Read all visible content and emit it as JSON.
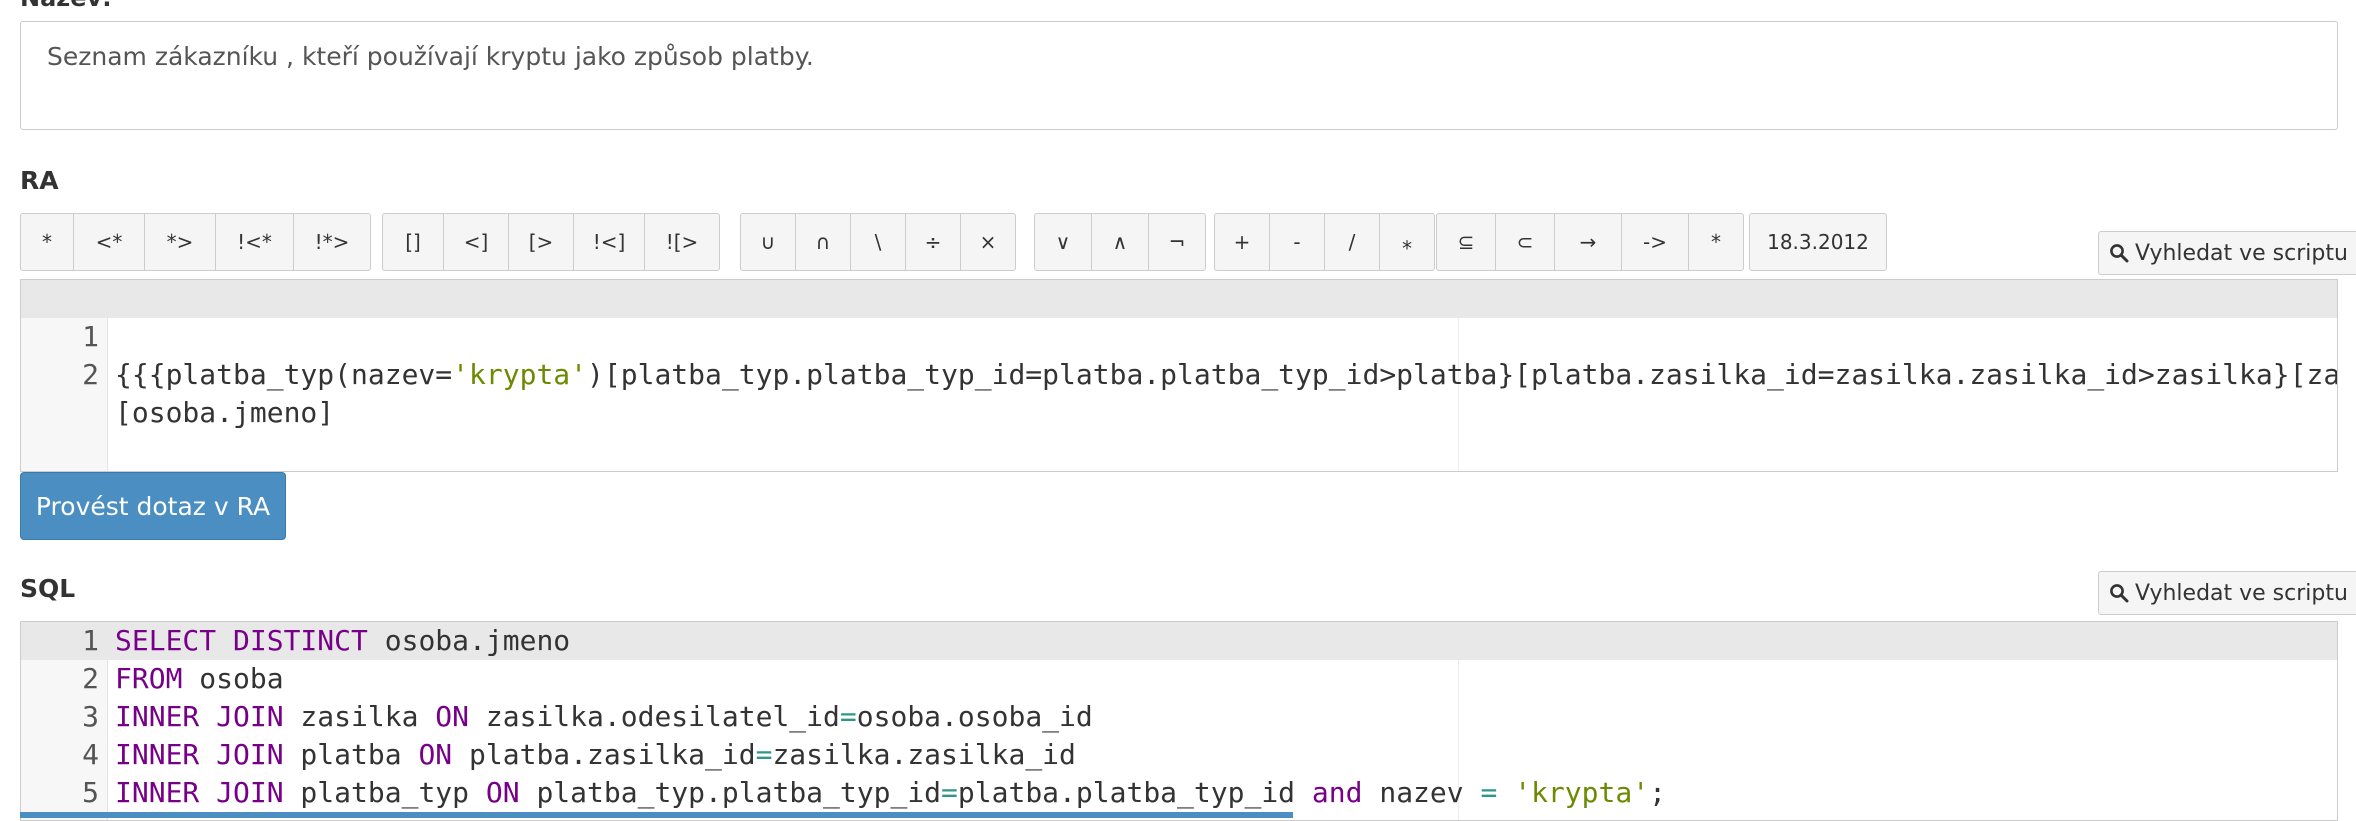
{
  "description": {
    "label": "Název:",
    "text": "Seznam zákazníku , kteří používají kryptu jako způsob platby."
  },
  "ra": {
    "label": "RA",
    "toolbar_groups": [
      [
        "*",
        "<*",
        "*>",
        "!<*",
        "!*>"
      ],
      [
        "[]",
        "<]",
        "[>",
        "!<]",
        "![>"
      ],
      [
        "∪",
        "∩",
        "\\",
        "÷",
        "×"
      ],
      [
        "∨",
        "∧",
        "¬"
      ],
      [
        "+",
        "-",
        "/",
        "⁎"
      ],
      [
        "⊆",
        "⊂",
        "→",
        "->",
        "*"
      ],
      [
        "18.3.2012"
      ]
    ],
    "search_label": "Vyhledat ve scriptu",
    "lines": [
      {
        "num": "1",
        "pre": "{{{platba_typ(nazev=",
        "str": "'krypta'",
        "post": ")[platba_typ.platba_typ_id=platba.platba_typ_id>platba}[platba.zasilka_id=zasilka.zasilka_id>zasilka}[zasilka.odesilatel_id=osoba.osoba_id>osoba}"
      },
      {
        "num": "2",
        "pre": "[osoba.jmeno]",
        "str": "",
        "post": ""
      }
    ],
    "run_label": "Provést dotaz v RA"
  },
  "sql": {
    "label": "SQL",
    "search_label": "Vyhledat ve scriptu",
    "lines": [
      {
        "num": "1",
        "segments": [
          {
            "t": "SELECT DISTINCT",
            "c": "kw"
          },
          {
            "t": " osoba.jmeno",
            "c": ""
          }
        ]
      },
      {
        "num": "2",
        "segments": [
          {
            "t": "FROM",
            "c": "kw"
          },
          {
            "t": " osoba",
            "c": ""
          }
        ]
      },
      {
        "num": "3",
        "segments": [
          {
            "t": "INNER JOIN",
            "c": "kw"
          },
          {
            "t": " zasilka ",
            "c": ""
          },
          {
            "t": "ON",
            "c": "kw"
          },
          {
            "t": " zasilka.odesilatel_id",
            "c": ""
          },
          {
            "t": "=",
            "c": "op"
          },
          {
            "t": "osoba.osoba_id",
            "c": ""
          }
        ]
      },
      {
        "num": "4",
        "segments": [
          {
            "t": "INNER JOIN",
            "c": "kw"
          },
          {
            "t": " platba ",
            "c": ""
          },
          {
            "t": "ON",
            "c": "kw"
          },
          {
            "t": " platba.zasilka_id",
            "c": ""
          },
          {
            "t": "=",
            "c": "op"
          },
          {
            "t": "zasilka.zasilka_id",
            "c": ""
          }
        ]
      },
      {
        "num": "5",
        "segments": [
          {
            "t": "INNER JOIN",
            "c": "kw"
          },
          {
            "t": " platba_typ ",
            "c": ""
          },
          {
            "t": "ON",
            "c": "kw"
          },
          {
            "t": " platba_typ.platba_typ_id",
            "c": ""
          },
          {
            "t": "=",
            "c": "op"
          },
          {
            "t": "platba.platba_typ_id ",
            "c": ""
          },
          {
            "t": "and",
            "c": "kw"
          },
          {
            "t": " nazev ",
            "c": ""
          },
          {
            "t": "=",
            "c": "op"
          },
          {
            "t": " ",
            "c": ""
          },
          {
            "t": "'krypta'",
            "c": "str"
          },
          {
            "t": ";",
            "c": ""
          }
        ]
      }
    ]
  },
  "colors": {
    "primary_button": "#4a8ec2",
    "keyword": "#770088",
    "string": "#6c8a00",
    "operator": "#31968a"
  }
}
